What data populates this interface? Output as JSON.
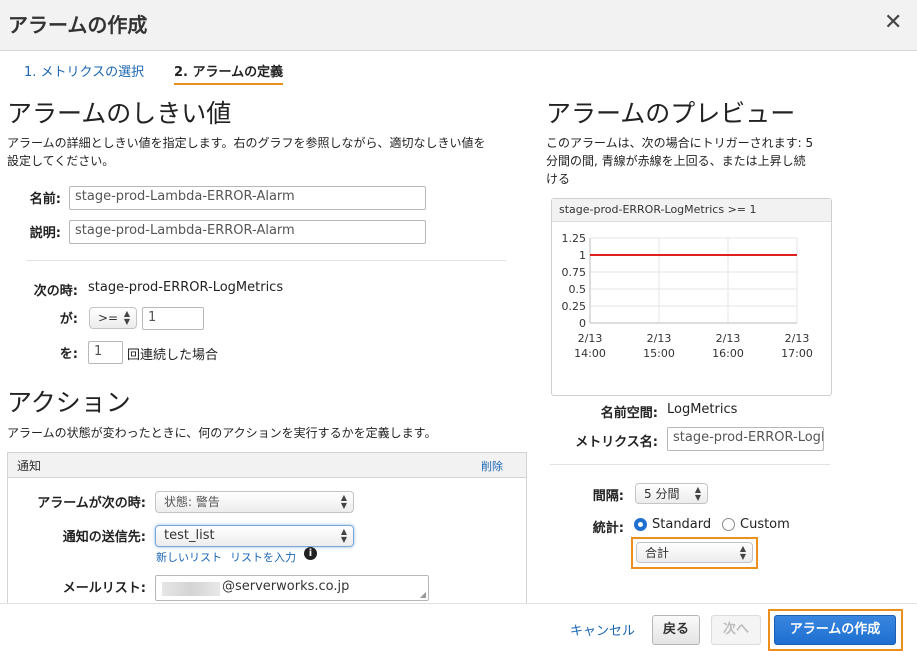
{
  "header": {
    "title": "アラームの作成",
    "close": "✕"
  },
  "steps": [
    {
      "label": "1. メトリクスの選択"
    },
    {
      "label": "2. アラームの定義"
    }
  ],
  "threshold": {
    "heading": "アラームのしきい値",
    "description_line1": "アラームの詳細としきい値を指定します。右のグラフを参照しながら、適切なしきい値を",
    "description_line2": "設定してください。",
    "name_label": "名前:",
    "name_value": "stage-prod-Lambda-ERROR-Alarm",
    "desc_label": "説明:",
    "desc_value": "stage-prod-Lambda-ERROR-Alarm",
    "when_label": "次の時:",
    "metric_name": "stage-prod-ERROR-LogMetrics",
    "is_label": "が:",
    "operator": ">=",
    "threshold_value": "1",
    "for_label": "を:",
    "periods": "1",
    "periods_suffix": "回連続した場合"
  },
  "actions": {
    "heading": "アクション",
    "description": "アラームの状態が変わったときに、何のアクションを実行するかを定義します。",
    "panel_title": "通知",
    "delete_link": "削除",
    "when_alarm_label": "アラームが次の時:",
    "state_value": "状態: 警告",
    "send_to_label": "通知の送信先:",
    "send_to_value": "test_list",
    "new_list_link": "新しいリスト",
    "enter_list_link": "リストを入力",
    "info_icon": "i",
    "email_label": "メールリスト:",
    "email_value": "@serverworks.co.jp"
  },
  "preview": {
    "heading": "アラームのプレビュー",
    "description_line1": "このアラームは、次の場合にトリガーされます: 5",
    "description_line2": "分間の間, 青線が赤線を上回る、または上昇し続",
    "description_line3": "ける",
    "namespace_label": "名前空間:",
    "namespace_value": "LogMetrics",
    "metric_label": "メトリクス名:",
    "metric_value": "stage-prod-ERROR-LogMetrics",
    "period_label": "間隔:",
    "period_value": "5 分間",
    "stat_label": "統計:",
    "stat_standard": "Standard",
    "stat_custom": "Custom",
    "stat_value": "合計"
  },
  "chart_data": {
    "type": "line",
    "title": "stage-prod-ERROR-LogMetrics >= 1",
    "ylim": [
      0,
      1.25
    ],
    "yticks": [
      1.25,
      1,
      0.75,
      0.5,
      0.25,
      0
    ],
    "xticks": [
      {
        "date": "2/13",
        "time": "14:00"
      },
      {
        "date": "2/13",
        "time": "15:00"
      },
      {
        "date": "2/13",
        "time": "16:00"
      },
      {
        "date": "2/13",
        "time": "17:00"
      }
    ],
    "series": [
      {
        "values": [
          1,
          1,
          1,
          1
        ],
        "color": "#e0201b"
      }
    ],
    "grid": true
  },
  "footer": {
    "cancel": "キャンセル",
    "back": "戻る",
    "next": "次へ",
    "create": "アラームの作成"
  },
  "colors": {
    "accent_orange": "#ec8f1c",
    "primary_blue": "#1e6fd0",
    "link_blue": "#1a66b3",
    "threshold_red": "#e0201b"
  }
}
